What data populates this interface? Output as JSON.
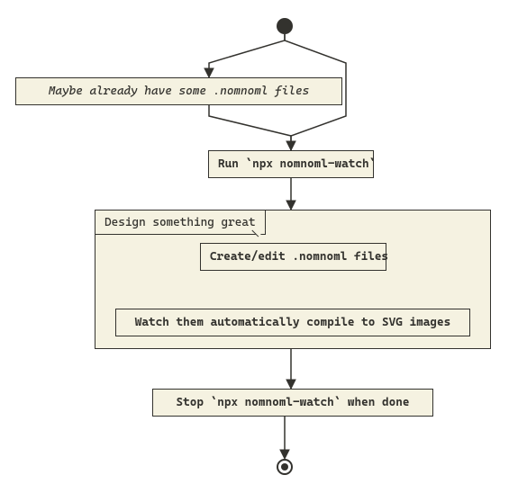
{
  "diagram": {
    "start": "start",
    "end": "end",
    "maybe_label": "Maybe already have some .nomnoml files",
    "run_label": "Run `npx nomnoml-watch`",
    "frame_title": "Design something great",
    "create_label": "Create/edit .nomnoml files",
    "watch_label": "Watch them automatically compile to SVG images",
    "stop_label": "Stop `npx nomnoml-watch` when done"
  },
  "colors": {
    "fill": "#f5f2e1",
    "stroke": "#33322e"
  }
}
